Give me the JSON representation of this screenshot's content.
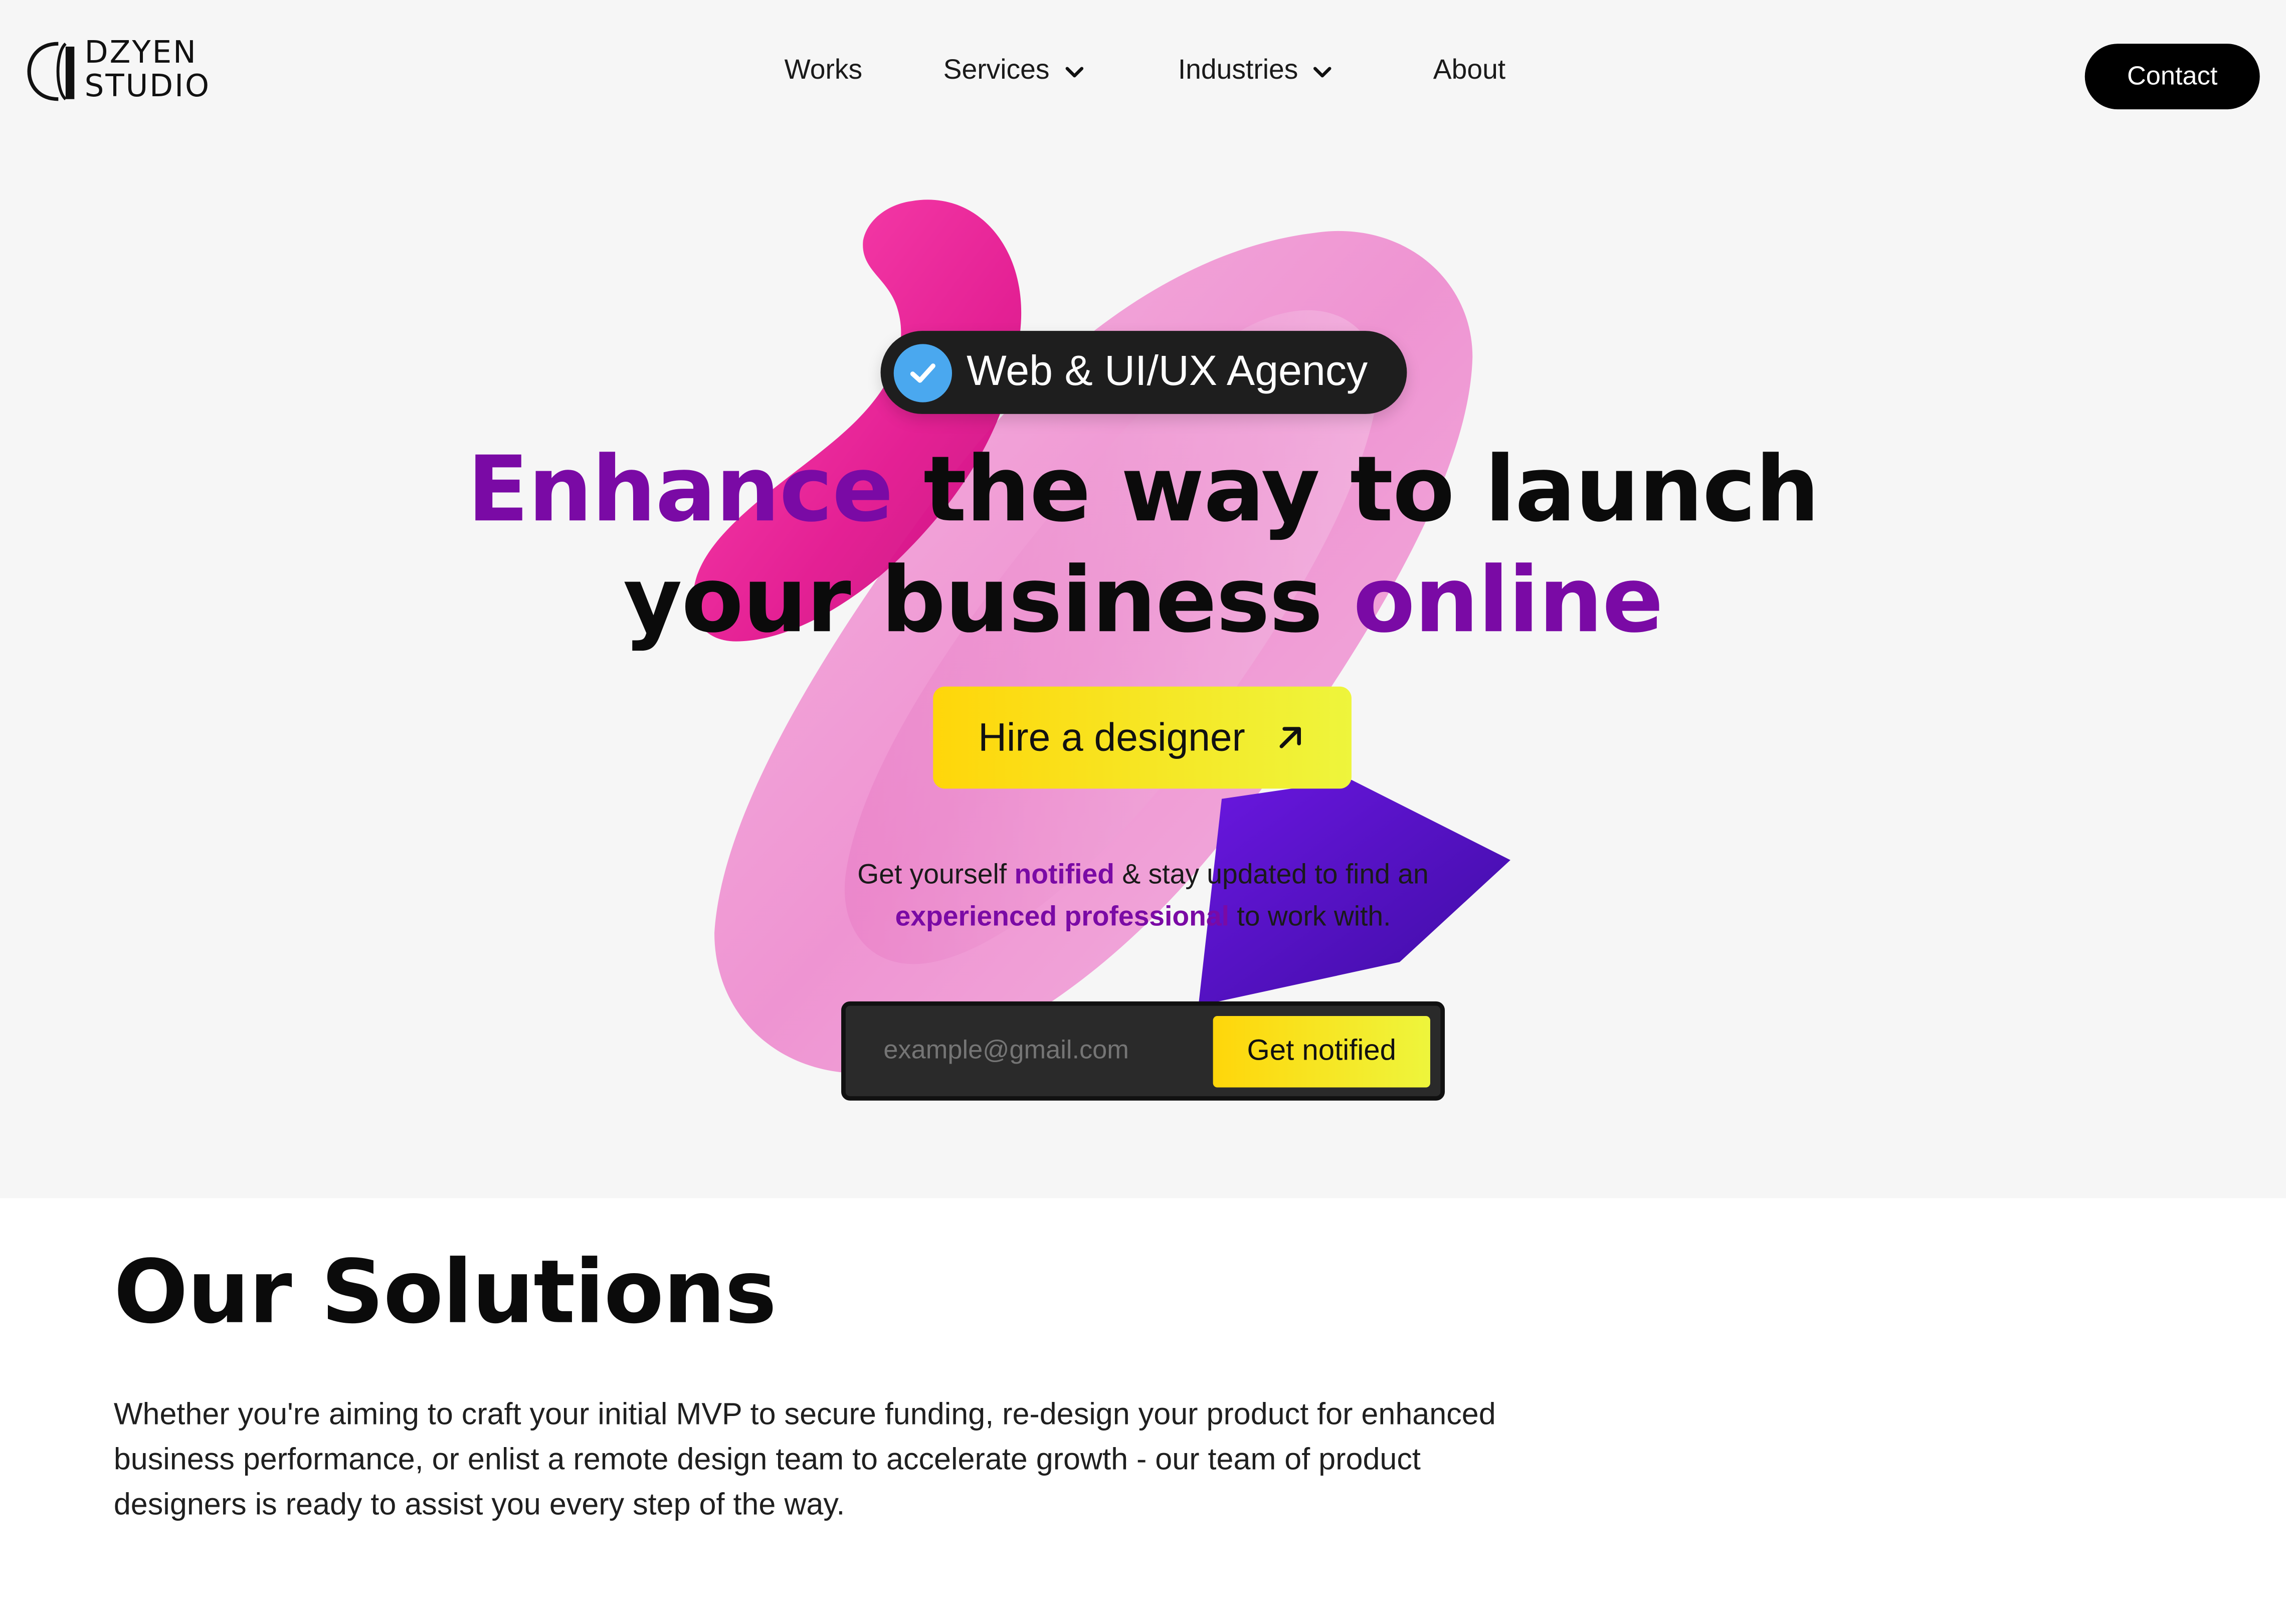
{
  "header": {
    "logo_line1": "DZYEN",
    "logo_line2": "STUDIO",
    "nav": [
      {
        "label": "Works",
        "has_dropdown": false
      },
      {
        "label": "Services",
        "has_dropdown": true
      },
      {
        "label": "Industries",
        "has_dropdown": true
      },
      {
        "label": "About",
        "has_dropdown": false
      }
    ],
    "contact_label": "Contact"
  },
  "hero": {
    "badge_label": "Web & UI/UX Agency",
    "headline": {
      "accent1": "Enhance",
      "part1": " the way to launch",
      "part2": "your business ",
      "accent2": "online"
    },
    "cta_label": "Hire a designer",
    "subtext": {
      "s1": "Get yourself ",
      "h1": "notified",
      "s2": " & stay updated to find an",
      "h2": "experienced professional",
      "s3": " to work with."
    },
    "email_placeholder": "example@gmail.com",
    "notify_label": "Get notified"
  },
  "solutions": {
    "title": "Our Solutions",
    "body": "Whether you're aiming to craft your initial MVP to secure funding, re-design your product for enhanced business performance, or enlist a remote design team to accelerate growth - our team of product designers is ready to assist you every step of the way."
  },
  "colors": {
    "accent_purple": "#7a0aa5",
    "cta_yellow": "#ffd60a",
    "badge_check_blue": "#4aa8ef"
  },
  "icons": [
    "check-icon",
    "arrow-up-right-icon",
    "chevron-down-icon"
  ]
}
